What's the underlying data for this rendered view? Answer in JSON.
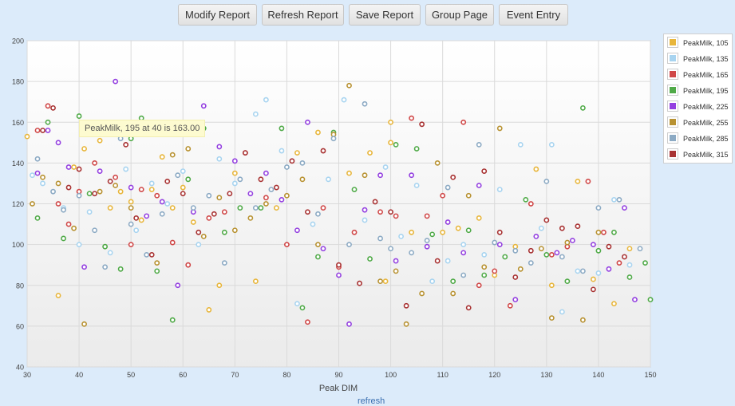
{
  "toolbar": {
    "buttons": [
      "Modify Report",
      "Refresh Report",
      "Save Report",
      "Group Page",
      "Event Entry"
    ]
  },
  "tooltip": {
    "text": "PeakMilk, 195 at 40 is 163.00"
  },
  "footer": {
    "link": "refresh"
  },
  "chart_data": {
    "type": "scatter",
    "title": "",
    "xlabel": "Peak DIM",
    "ylabel": "",
    "xlim": [
      30,
      150
    ],
    "ylim": [
      40,
      200
    ],
    "xticks": [
      30,
      40,
      50,
      60,
      70,
      80,
      90,
      100,
      110,
      120,
      130,
      140,
      150
    ],
    "yticks": [
      40,
      60,
      80,
      100,
      120,
      140,
      160,
      180,
      200
    ],
    "grid": true,
    "legend_position": "right",
    "series": [
      {
        "name": "PeakMilk, 105",
        "color": "#e8b63c",
        "points": [
          [
            30,
            153
          ],
          [
            36,
            75
          ],
          [
            39,
            138
          ],
          [
            41,
            147
          ],
          [
            44,
            151
          ],
          [
            46,
            118
          ],
          [
            48,
            126
          ],
          [
            50,
            121
          ],
          [
            52,
            112
          ],
          [
            54,
            127
          ],
          [
            56,
            143
          ],
          [
            58,
            118
          ],
          [
            60,
            128
          ],
          [
            62,
            111
          ],
          [
            65,
            68
          ],
          [
            67,
            80
          ],
          [
            70,
            135
          ],
          [
            74,
            82
          ],
          [
            78,
            118
          ],
          [
            82,
            145
          ],
          [
            86,
            155
          ],
          [
            92,
            135
          ],
          [
            96,
            145
          ],
          [
            99,
            82
          ],
          [
            100,
            160
          ],
          [
            100,
            150
          ],
          [
            104,
            106
          ],
          [
            110,
            106
          ],
          [
            113,
            108
          ],
          [
            117,
            113
          ],
          [
            120,
            85
          ],
          [
            124,
            99
          ],
          [
            128,
            137
          ],
          [
            131,
            80
          ],
          [
            136,
            131
          ],
          [
            139,
            83
          ],
          [
            143,
            71
          ],
          [
            146,
            98
          ]
        ]
      },
      {
        "name": "PeakMilk, 135",
        "color": "#a8d4f0",
        "points": [
          [
            31,
            134
          ],
          [
            33,
            130
          ],
          [
            37,
            118
          ],
          [
            40,
            100
          ],
          [
            42,
            116
          ],
          [
            46,
            96
          ],
          [
            49,
            137
          ],
          [
            51,
            107
          ],
          [
            54,
            130
          ],
          [
            57,
            120
          ],
          [
            60,
            136
          ],
          [
            63,
            100
          ],
          [
            67,
            142
          ],
          [
            70,
            130
          ],
          [
            74,
            164
          ],
          [
            76,
            171
          ],
          [
            79,
            146
          ],
          [
            82,
            71
          ],
          [
            85,
            110
          ],
          [
            88,
            132
          ],
          [
            91,
            171
          ],
          [
            95,
            112
          ],
          [
            99,
            138
          ],
          [
            102,
            104
          ],
          [
            105,
            129
          ],
          [
            108,
            82
          ],
          [
            111,
            92
          ],
          [
            114,
            100
          ],
          [
            118,
            95
          ],
          [
            121,
            127
          ],
          [
            125,
            149
          ],
          [
            129,
            108
          ],
          [
            131,
            149
          ],
          [
            133,
            67
          ],
          [
            136,
            87
          ],
          [
            140,
            86
          ],
          [
            143,
            122
          ],
          [
            146,
            90
          ]
        ]
      },
      {
        "name": "PeakMilk, 165",
        "color": "#d04848",
        "points": [
          [
            32,
            156
          ],
          [
            34,
            168
          ],
          [
            36,
            120
          ],
          [
            38,
            110
          ],
          [
            40,
            126
          ],
          [
            43,
            140
          ],
          [
            45,
            154
          ],
          [
            47,
            133
          ],
          [
            50,
            100
          ],
          [
            52,
            127
          ],
          [
            55,
            124
          ],
          [
            58,
            101
          ],
          [
            61,
            90
          ],
          [
            65,
            113
          ],
          [
            68,
            116
          ],
          [
            72,
            145
          ],
          [
            76,
            123
          ],
          [
            80,
            100
          ],
          [
            84,
            62
          ],
          [
            87,
            118
          ],
          [
            90,
            89
          ],
          [
            93,
            106
          ],
          [
            98,
            116
          ],
          [
            101,
            114
          ],
          [
            104,
            162
          ],
          [
            107,
            114
          ],
          [
            110,
            124
          ],
          [
            114,
            160
          ],
          [
            117,
            80
          ],
          [
            120,
            87
          ],
          [
            123,
            70
          ],
          [
            127,
            120
          ],
          [
            131,
            95
          ],
          [
            134,
            99
          ],
          [
            138,
            131
          ],
          [
            141,
            106
          ],
          [
            144,
            91
          ]
        ]
      },
      {
        "name": "PeakMilk, 195",
        "color": "#50aa48",
        "points": [
          [
            32,
            113
          ],
          [
            34,
            160
          ],
          [
            37,
            103
          ],
          [
            40,
            163
          ],
          [
            42,
            125
          ],
          [
            45,
            99
          ],
          [
            48,
            88
          ],
          [
            50,
            152
          ],
          [
            52,
            162
          ],
          [
            55,
            87
          ],
          [
            58,
            63
          ],
          [
            61,
            132
          ],
          [
            64,
            157
          ],
          [
            68,
            106
          ],
          [
            71,
            118
          ],
          [
            75,
            118
          ],
          [
            79,
            157
          ],
          [
            83,
            69
          ],
          [
            86,
            94
          ],
          [
            89,
            155
          ],
          [
            93,
            127
          ],
          [
            96,
            93
          ],
          [
            101,
            149
          ],
          [
            105,
            147
          ],
          [
            108,
            105
          ],
          [
            112,
            82
          ],
          [
            115,
            107
          ],
          [
            118,
            85
          ],
          [
            122,
            94
          ],
          [
            126,
            122
          ],
          [
            130,
            95
          ],
          [
            134,
            82
          ],
          [
            137,
            167
          ],
          [
            140,
            97
          ],
          [
            143,
            106
          ],
          [
            146,
            84
          ],
          [
            149,
            91
          ],
          [
            150,
            73
          ]
        ]
      },
      {
        "name": "PeakMilk, 225",
        "color": "#9440e0",
        "points": [
          [
            32,
            135
          ],
          [
            34,
            156
          ],
          [
            36,
            150
          ],
          [
            38,
            138
          ],
          [
            41,
            89
          ],
          [
            44,
            136
          ],
          [
            47,
            180
          ],
          [
            50,
            128
          ],
          [
            53,
            114
          ],
          [
            56,
            121
          ],
          [
            59,
            80
          ],
          [
            62,
            116
          ],
          [
            64,
            168
          ],
          [
            67,
            148
          ],
          [
            70,
            141
          ],
          [
            73,
            125
          ],
          [
            76,
            135
          ],
          [
            79,
            122
          ],
          [
            82,
            107
          ],
          [
            84,
            160
          ],
          [
            87,
            98
          ],
          [
            90,
            85
          ],
          [
            92,
            61
          ],
          [
            95,
            117
          ],
          [
            98,
            134
          ],
          [
            101,
            92
          ],
          [
            104,
            134
          ],
          [
            107,
            99
          ],
          [
            111,
            111
          ],
          [
            114,
            96
          ],
          [
            117,
            129
          ],
          [
            121,
            100
          ],
          [
            124,
            73
          ],
          [
            128,
            104
          ],
          [
            132,
            96
          ],
          [
            135,
            102
          ],
          [
            139,
            100
          ],
          [
            142,
            88
          ],
          [
            145,
            118
          ],
          [
            147,
            73
          ]
        ]
      },
      {
        "name": "PeakMilk, 255",
        "color": "#b89232",
        "points": [
          [
            31,
            120
          ],
          [
            33,
            133
          ],
          [
            36,
            130
          ],
          [
            39,
            108
          ],
          [
            41,
            61
          ],
          [
            44,
            126
          ],
          [
            47,
            129
          ],
          [
            50,
            118
          ],
          [
            53,
            157
          ],
          [
            55,
            91
          ],
          [
            58,
            144
          ],
          [
            61,
            147
          ],
          [
            64,
            104
          ],
          [
            67,
            123
          ],
          [
            70,
            107
          ],
          [
            73,
            113
          ],
          [
            76,
            120
          ],
          [
            80,
            124
          ],
          [
            83,
            132
          ],
          [
            86,
            100
          ],
          [
            89,
            154
          ],
          [
            92,
            178
          ],
          [
            95,
            134
          ],
          [
            98,
            82
          ],
          [
            101,
            87
          ],
          [
            103,
            61
          ],
          [
            106,
            76
          ],
          [
            109,
            140
          ],
          [
            112,
            76
          ],
          [
            115,
            124
          ],
          [
            118,
            89
          ],
          [
            121,
            157
          ],
          [
            125,
            88
          ],
          [
            129,
            98
          ],
          [
            131,
            64
          ],
          [
            134,
            101
          ],
          [
            137,
            63
          ],
          [
            140,
            106
          ]
        ]
      },
      {
        "name": "PeakMilk, 285",
        "color": "#8caac4",
        "points": [
          [
            32,
            142
          ],
          [
            35,
            126
          ],
          [
            37,
            117
          ],
          [
            40,
            124
          ],
          [
            43,
            107
          ],
          [
            45,
            89
          ],
          [
            48,
            152
          ],
          [
            50,
            110
          ],
          [
            53,
            95
          ],
          [
            56,
            115
          ],
          [
            59,
            134
          ],
          [
            62,
            118
          ],
          [
            65,
            124
          ],
          [
            68,
            91
          ],
          [
            71,
            132
          ],
          [
            74,
            118
          ],
          [
            77,
            127
          ],
          [
            80,
            138
          ],
          [
            83,
            140
          ],
          [
            86,
            115
          ],
          [
            89,
            152
          ],
          [
            92,
            100
          ],
          [
            95,
            169
          ],
          [
            98,
            103
          ],
          [
            100,
            98
          ],
          [
            104,
            96
          ],
          [
            107,
            102
          ],
          [
            111,
            128
          ],
          [
            114,
            85
          ],
          [
            117,
            149
          ],
          [
            120,
            101
          ],
          [
            124,
            97
          ],
          [
            127,
            91
          ],
          [
            130,
            131
          ],
          [
            133,
            94
          ],
          [
            137,
            87
          ],
          [
            140,
            118
          ],
          [
            144,
            122
          ],
          [
            148,
            98
          ]
        ]
      },
      {
        "name": "PeakMilk, 315",
        "color": "#a83232",
        "points": [
          [
            33,
            156
          ],
          [
            35,
            167
          ],
          [
            38,
            128
          ],
          [
            40,
            137
          ],
          [
            43,
            125
          ],
          [
            46,
            131
          ],
          [
            49,
            149
          ],
          [
            51,
            113
          ],
          [
            54,
            95
          ],
          [
            57,
            131
          ],
          [
            60,
            125
          ],
          [
            63,
            106
          ],
          [
            66,
            115
          ],
          [
            69,
            125
          ],
          [
            72,
            145
          ],
          [
            75,
            132
          ],
          [
            78,
            128
          ],
          [
            81,
            141
          ],
          [
            84,
            116
          ],
          [
            87,
            146
          ],
          [
            90,
            90
          ],
          [
            94,
            81
          ],
          [
            97,
            121
          ],
          [
            100,
            116
          ],
          [
            103,
            70
          ],
          [
            106,
            159
          ],
          [
            109,
            92
          ],
          [
            112,
            133
          ],
          [
            115,
            69
          ],
          [
            118,
            136
          ],
          [
            121,
            106
          ],
          [
            124,
            84
          ],
          [
            127,
            97
          ],
          [
            130,
            112
          ],
          [
            133,
            108
          ],
          [
            136,
            109
          ],
          [
            139,
            78
          ],
          [
            142,
            99
          ],
          [
            145,
            94
          ]
        ]
      }
    ]
  }
}
